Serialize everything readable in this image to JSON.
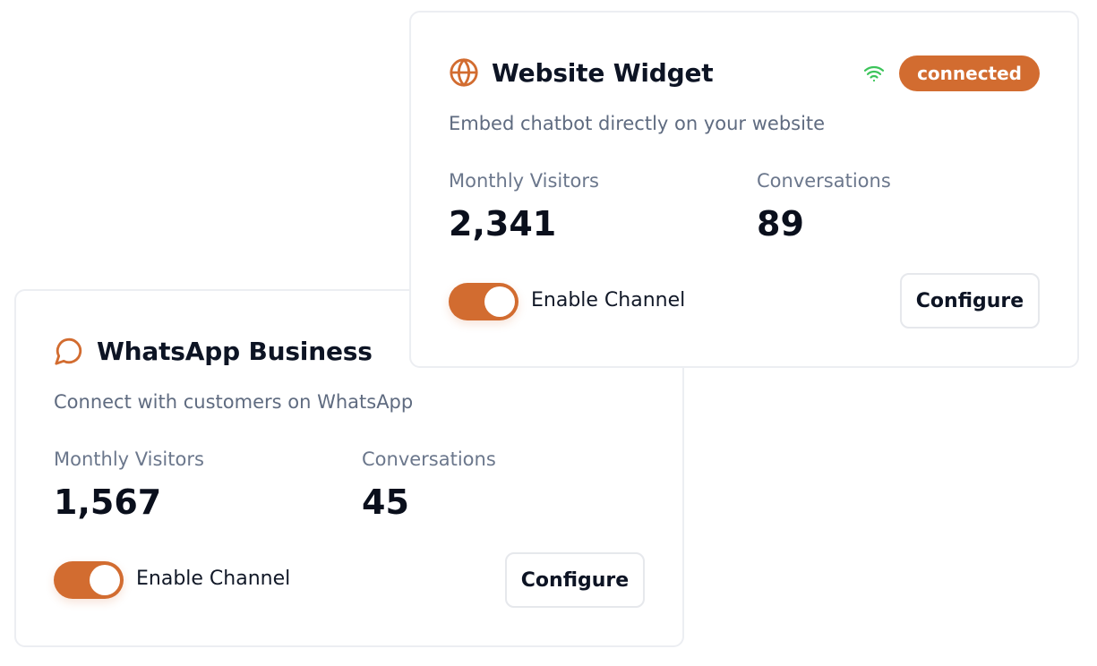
{
  "colors": {
    "accent": "#d26c30",
    "status_online": "#3cc45a",
    "title": "#0d1424",
    "muted": "#6b778c"
  },
  "channels": [
    {
      "title": "WhatsApp Business",
      "icon": "message-circle-icon",
      "description": "Connect with customers on WhatsApp",
      "stats": [
        {
          "label": "Monthly Visitors",
          "value": "1,567"
        },
        {
          "label": "Conversations",
          "value": "45"
        }
      ],
      "toggle": {
        "label": "Enable Channel",
        "enabled": true
      },
      "configure_label": "Configure"
    },
    {
      "title": "Website Widget",
      "icon": "globe-icon",
      "description": "Embed chatbot directly on your website",
      "status": {
        "icon": "wifi-icon",
        "label": "connected"
      },
      "stats": [
        {
          "label": "Monthly Visitors",
          "value": "2,341"
        },
        {
          "label": "Conversations",
          "value": "89"
        }
      ],
      "toggle": {
        "label": "Enable Channel",
        "enabled": true
      },
      "configure_label": "Configure"
    }
  ]
}
